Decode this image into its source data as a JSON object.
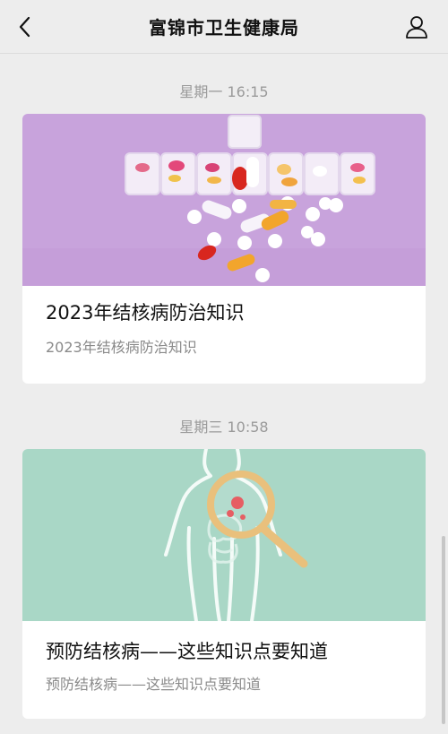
{
  "header": {
    "title": "富锦市卫生健康局",
    "back_icon": "chevron-left-icon",
    "profile_icon": "user-icon"
  },
  "feed": [
    {
      "timestamp": "星期一 16:15",
      "title": "2023年结核病防治知识",
      "description": "2023年结核病防治知识",
      "cover": "pills-organizer-image",
      "cover_color": "#c8a3dc"
    },
    {
      "timestamp": "星期三 10:58",
      "title": "预防结核病——这些知识点要知道",
      "description": "预防结核病——这些知识点要知道",
      "cover": "body-magnifier-image",
      "cover_color": "#a9d7c6"
    }
  ]
}
